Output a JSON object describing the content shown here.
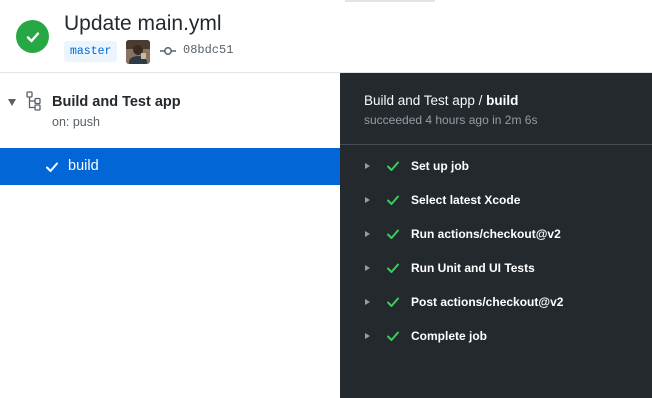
{
  "header": {
    "run_title": "Update main.yml",
    "branch": "master",
    "commit_sha": "08bdc51",
    "status_icon": "check-circle-icon",
    "status_color": "#28a745"
  },
  "sidebar": {
    "workflow_name": "Build and Test app",
    "workflow_trigger": "on: push",
    "job_name": "build",
    "selected_color": "#0366d6"
  },
  "panel": {
    "title_prefix": "Build and Test app / ",
    "title_job": "build",
    "subtitle": "succeeded 4 hours ago in 2m 6s",
    "background": "#24292e",
    "steps": [
      {
        "label": "Set up job",
        "status": "success"
      },
      {
        "label": "Select latest Xcode",
        "status": "success"
      },
      {
        "label": "Run actions/checkout@v2",
        "status": "success"
      },
      {
        "label": "Run Unit and UI Tests",
        "status": "success"
      },
      {
        "label": "Post actions/checkout@v2",
        "status": "success"
      },
      {
        "label": "Complete job",
        "status": "success"
      }
    ]
  }
}
